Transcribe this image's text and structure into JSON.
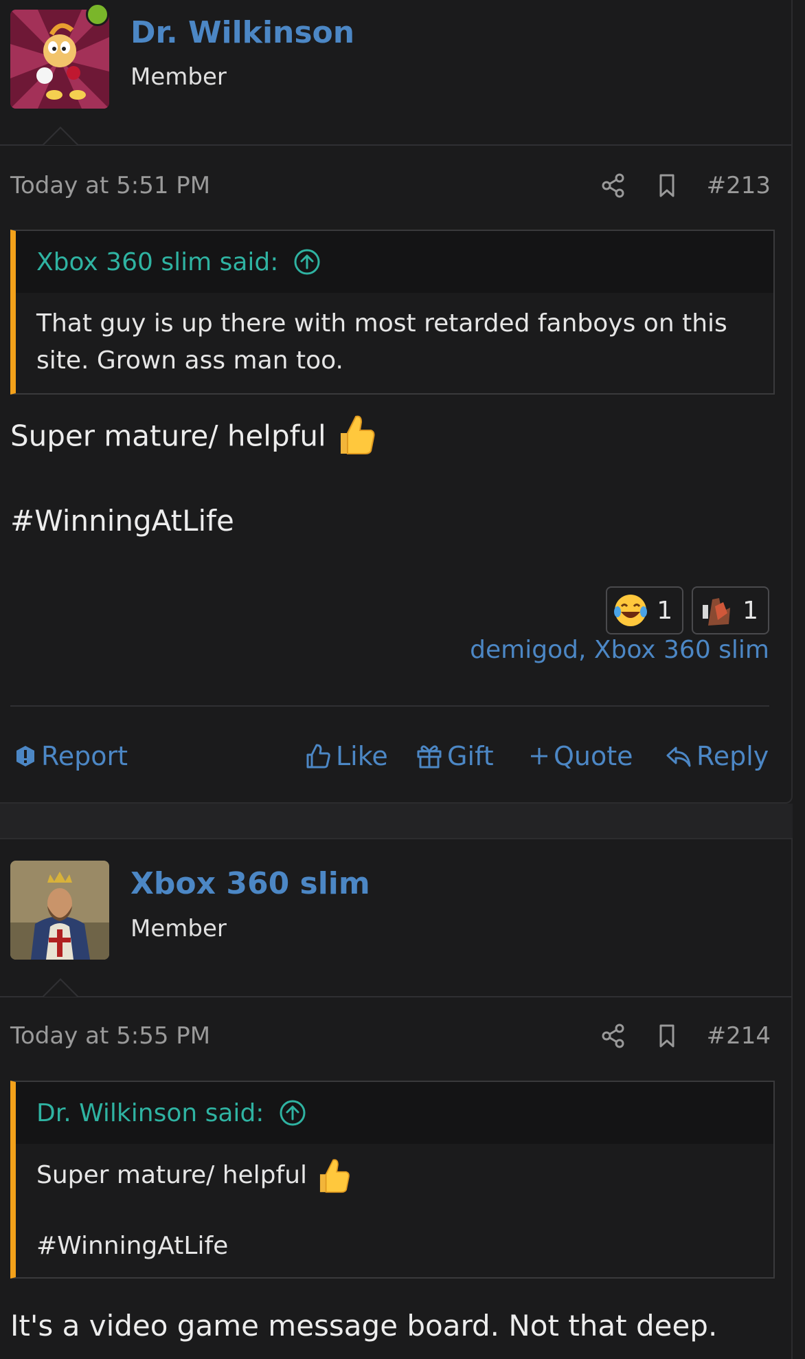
{
  "posts": [
    {
      "author": "Dr. Wilkinson",
      "role": "Member",
      "online": true,
      "time": "Today at 5:51 PM",
      "number": "#213",
      "quote": {
        "author_line": "Xbox 360 slim said:",
        "text": "That guy is up there with most retarded fanboys on this site. Grown ass man too."
      },
      "message_line1": "Super mature/ helpful",
      "message_line2": "#WinningAtLife",
      "reactions": [
        {
          "icon": "laughing-tears-emoji-icon",
          "count": "1"
        },
        {
          "icon": "custom-reaction-image-icon",
          "count": "1"
        }
      ],
      "reactors": "demigod, Xbox 360 slim",
      "actions": {
        "report": "Report",
        "like": "Like",
        "gift": "Gift",
        "quote": "Quote",
        "reply": "Reply"
      }
    },
    {
      "author": "Xbox 360 slim",
      "role": "Member",
      "online": false,
      "time": "Today at 5:55 PM",
      "number": "#214",
      "quote": {
        "author_line": "Dr. Wilkinson said:",
        "text_line1": "Super mature/ helpful",
        "text_line2": "#WinningAtLife"
      },
      "message": "It's a video game message board. Not that deep."
    }
  ],
  "colors": {
    "background": "#1b1b1c",
    "username": "#4c87c5",
    "quote_accent": "#f3a11a",
    "quote_author": "#2fb3a2",
    "online": "#7ab62a"
  }
}
